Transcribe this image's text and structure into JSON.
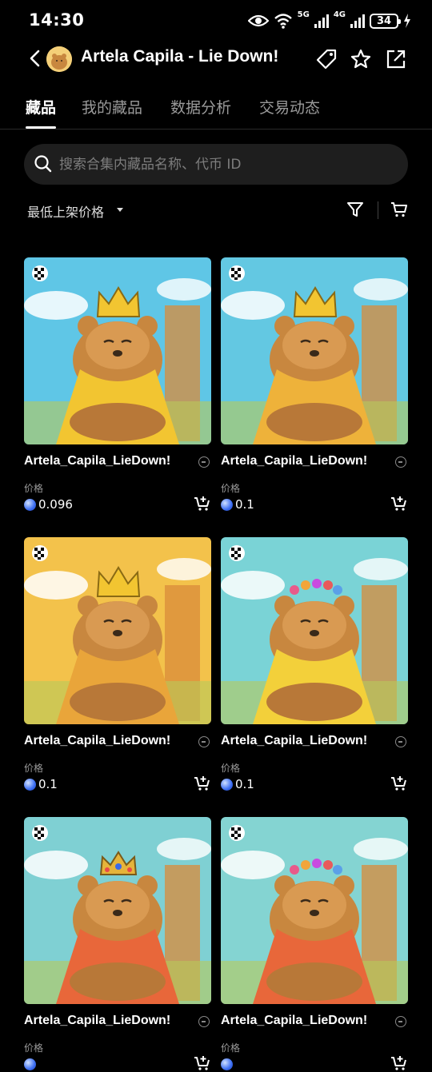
{
  "status_bar": {
    "time": "14:30",
    "network_a": "5G",
    "network_b": "4G",
    "battery": "34"
  },
  "header": {
    "title": "Artela Capila - Lie Down!"
  },
  "tabs": [
    {
      "label": "藏品",
      "active": true
    },
    {
      "label": "我的藏品",
      "active": false
    },
    {
      "label": "数据分析",
      "active": false
    },
    {
      "label": "交易动态",
      "active": false
    }
  ],
  "search": {
    "placeholder": "搜索合集内藏品名称、代币 ID"
  },
  "sort": {
    "label": "最低上架价格"
  },
  "items": [
    {
      "name": "Artela_Capila_LieDown!",
      "price_label": "价格",
      "price": "0.096",
      "sky": "#5fc6e6",
      "cape": "#f2c531",
      "crown": "gold"
    },
    {
      "name": "Artela_Capila_LieDown!",
      "price_label": "价格",
      "price": "0.1",
      "sky": "#63c8e2",
      "cape": "#eeb23a",
      "crown": "gold"
    },
    {
      "name": "Artela_Capila_LieDown!",
      "price_label": "价格",
      "price": "0.1",
      "sky": "#f3c24b",
      "cape": "#e9a53a",
      "crown": "gold"
    },
    {
      "name": "Artela_Capila_LieDown!",
      "price_label": "价格",
      "price": "0.1",
      "sky": "#7ad3d6",
      "cape": "#f3d03a",
      "crown": "flowers"
    },
    {
      "name": "Artela_Capila_LieDown!",
      "price_label": "价格",
      "price": "",
      "sky": "#7fd0d3",
      "cape": "#e8673a",
      "crown": "jewel"
    },
    {
      "name": "Artela_Capila_LieDown!",
      "price_label": "价格",
      "price": "",
      "sky": "#84d4d2",
      "cape": "#e8673a",
      "crown": "flowers"
    }
  ]
}
